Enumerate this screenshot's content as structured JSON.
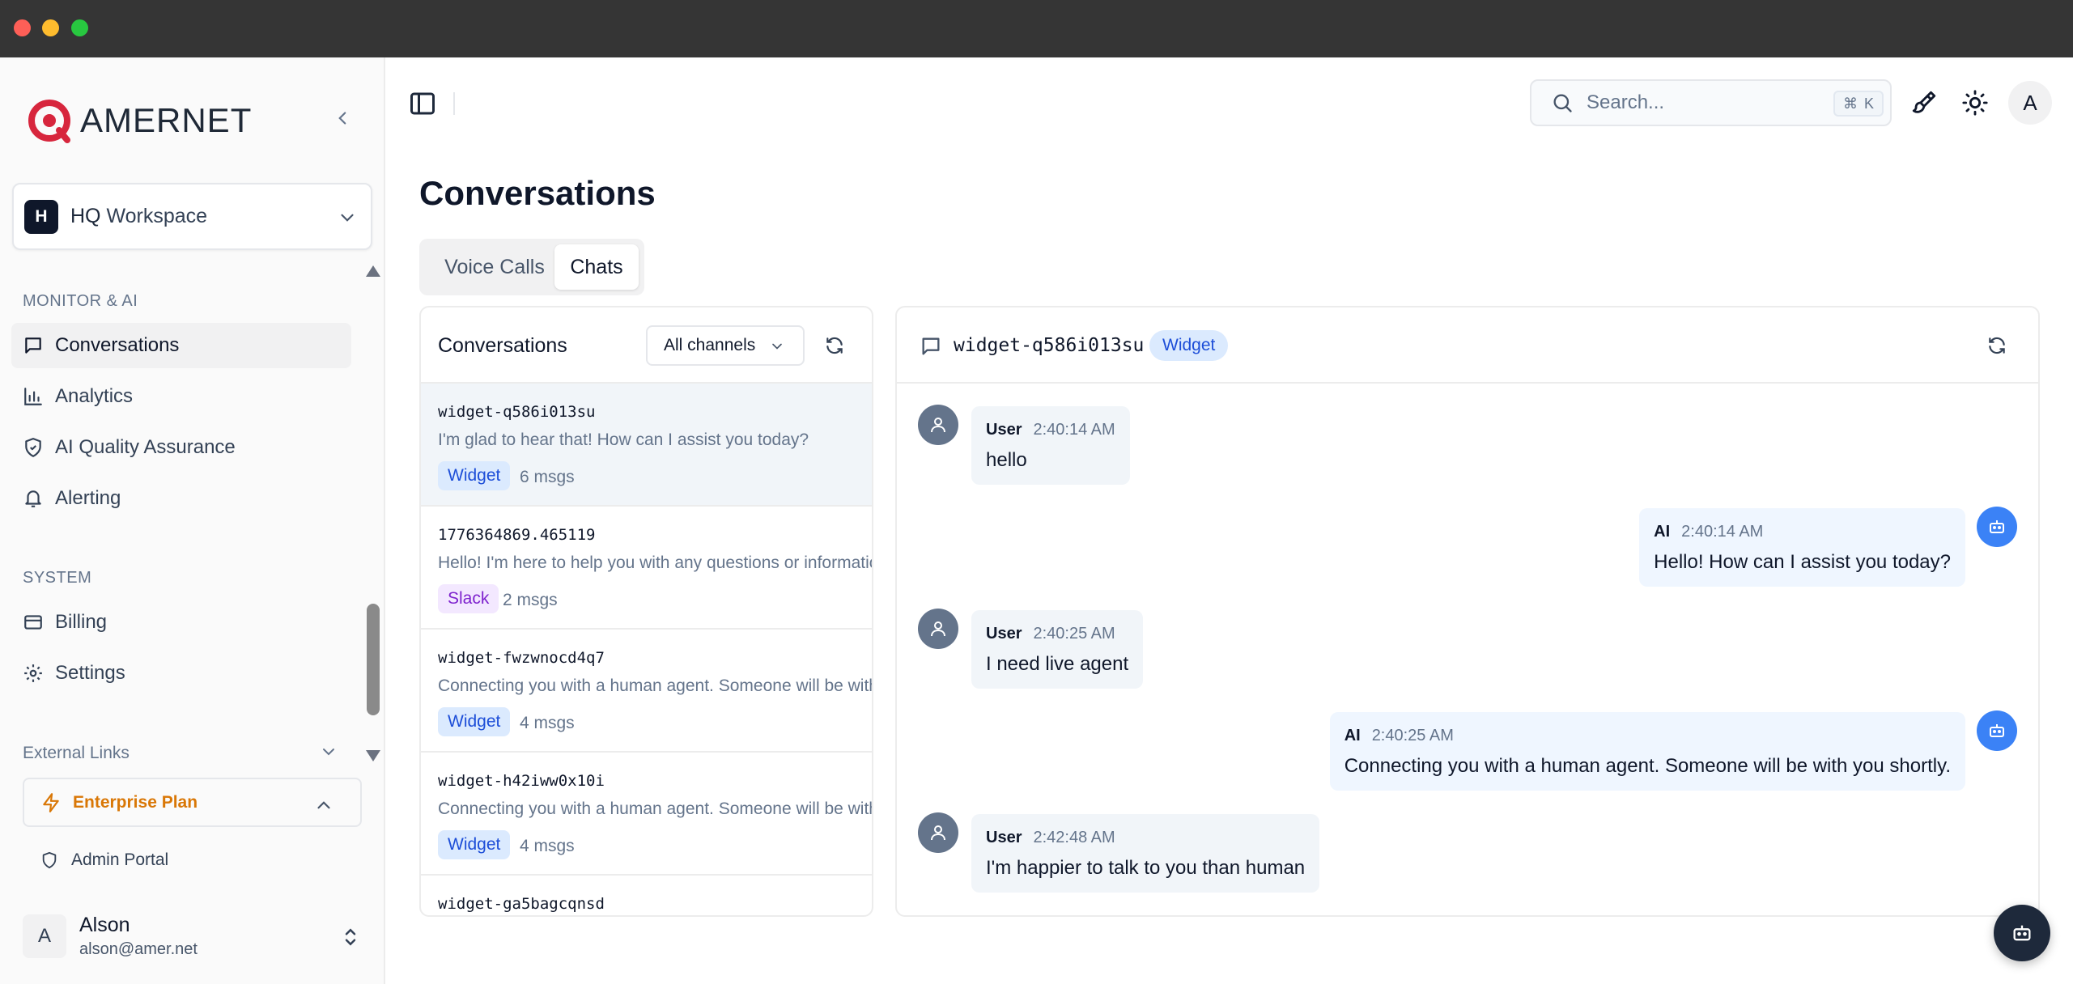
{
  "brand": {
    "name": "AMERNET",
    "accent": "#d7263d"
  },
  "workspace": {
    "initial": "H",
    "name": "HQ",
    "name_suffix": " Workspace"
  },
  "sidebar": {
    "section_monitor": "MONITOR & AI",
    "monitor_items": [
      {
        "label": "Conversations",
        "icon": "message-square-icon"
      },
      {
        "label": "Analytics",
        "icon": "bar-chart-icon"
      },
      {
        "label": "AI Quality Assurance",
        "icon": "shield-check-icon"
      },
      {
        "label": "Alerting",
        "icon": "bell-icon"
      }
    ],
    "section_system": "SYSTEM",
    "system_items": [
      {
        "label": "Billing",
        "icon": "credit-card-icon"
      },
      {
        "label": "Settings",
        "icon": "gear-icon"
      }
    ],
    "external_links": "External Links",
    "plan": "Enterprise Plan",
    "admin_portal": "Admin Portal"
  },
  "user": {
    "initial": "A",
    "name": "Alson",
    "email": "alson@amer.net"
  },
  "topbar": {
    "search_placeholder": "Search...",
    "shortcut_cmd": "⌘",
    "shortcut_key": "K",
    "avatar_initial": "A"
  },
  "page": {
    "title": "Conversations",
    "tabs": [
      {
        "label": "Voice Calls"
      },
      {
        "label": "Chats"
      }
    ]
  },
  "list": {
    "title": "Conversations",
    "channel_filter": "All channels",
    "items": [
      {
        "id": "widget-q586i013su",
        "preview": "I'm glad to hear that! How can I assist you today?",
        "channel": "Widget",
        "count": "6 msgs"
      },
      {
        "id": "1776364869.465119",
        "preview": "Hello! I'm here to help you with any questions or information",
        "channel": "Slack",
        "count": "2 msgs"
      },
      {
        "id": "widget-fwzwnocd4q7",
        "preview": "Connecting you with a human agent. Someone will be with you shortly.",
        "channel": "Widget",
        "count": "4 msgs"
      },
      {
        "id": "widget-h42iww0x10i",
        "preview": "Connecting you with a human agent. Someone will be with you shortly.",
        "channel": "Widget",
        "count": "4 msgs"
      },
      {
        "id": "widget-ga5bagcqnsd",
        "preview": "",
        "channel": "",
        "count": ""
      }
    ]
  },
  "chat": {
    "id": "widget-q586i013su",
    "channel": "Widget",
    "messages": [
      {
        "role": "User",
        "time": "2:40:14 AM",
        "text": "hello"
      },
      {
        "role": "AI",
        "time": "2:40:14 AM",
        "text": "Hello! How can I assist you today?"
      },
      {
        "role": "User",
        "time": "2:40:25 AM",
        "text": "I need live agent"
      },
      {
        "role": "AI",
        "time": "2:40:25 AM",
        "text": "Connecting you with a human agent. Someone will be with you shortly."
      },
      {
        "role": "User",
        "time": "2:42:48 AM",
        "text": "I'm happier to talk to you than human"
      }
    ]
  },
  "colors": {
    "widget_badge_bg": "#dbeafe",
    "slack_badge_bg": "#f3e8ff",
    "ai_avatar": "#3b82f6",
    "user_avatar": "#64748b",
    "plan_accent": "#d97706"
  }
}
